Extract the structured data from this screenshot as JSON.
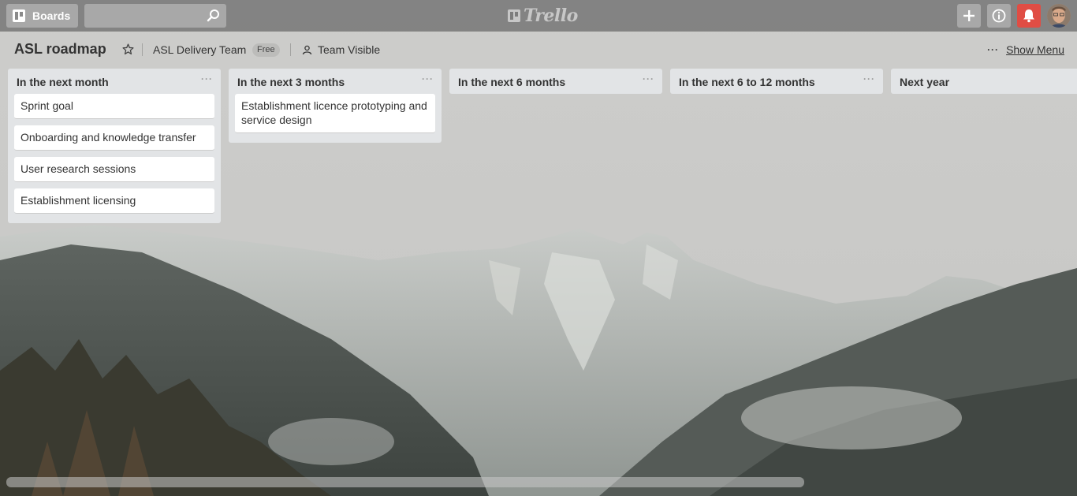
{
  "header": {
    "boards_label": "Boards",
    "search_value": "",
    "logo_text": "Trello"
  },
  "board": {
    "title": "ASL roadmap",
    "team": "ASL Delivery Team",
    "plan_badge": "Free",
    "visibility": "Team Visible",
    "show_menu_label": "Show Menu",
    "menu_dots": "···"
  },
  "lists": [
    {
      "title": "In the next month",
      "menu": "···",
      "cards": [
        "Sprint goal",
        "Onboarding and knowledge transfer",
        "User research sessions",
        "Establishment licensing"
      ]
    },
    {
      "title": "In the next 3 months",
      "menu": "···",
      "cards": [
        "Establishment licence prototyping and service design"
      ]
    },
    {
      "title": "In the next 6 months",
      "menu": "···",
      "cards": []
    },
    {
      "title": "In the next 6 to 12 months",
      "menu": "···",
      "cards": []
    },
    {
      "title": "Next year",
      "menu": "",
      "cards": []
    }
  ],
  "colors": {
    "notification": "#e04d44",
    "list_bg": "#e2e4e6",
    "header_bg": "#6e6e6e"
  }
}
